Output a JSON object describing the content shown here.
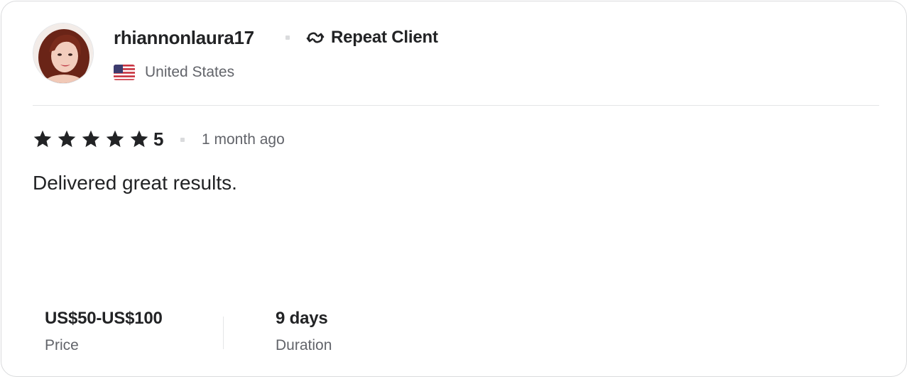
{
  "reviewer": {
    "username": "rhiannonlaura17",
    "badge_label": "Repeat Client",
    "badge_icon": "repeat-icon",
    "country": "United States",
    "flag_icon": "us-flag-icon"
  },
  "review": {
    "rating_value": "5",
    "stars": 5,
    "time_ago": "1 month ago",
    "text": "Delivered great results."
  },
  "stats": {
    "price_value": "US$50-US$100",
    "price_label": "Price",
    "duration_value": "9 days",
    "duration_label": "Duration"
  },
  "colors": {
    "text_primary": "#222325",
    "text_secondary": "#62646a",
    "border": "#dadbdd",
    "divider": "#e4e5e7",
    "star": "#222325"
  }
}
